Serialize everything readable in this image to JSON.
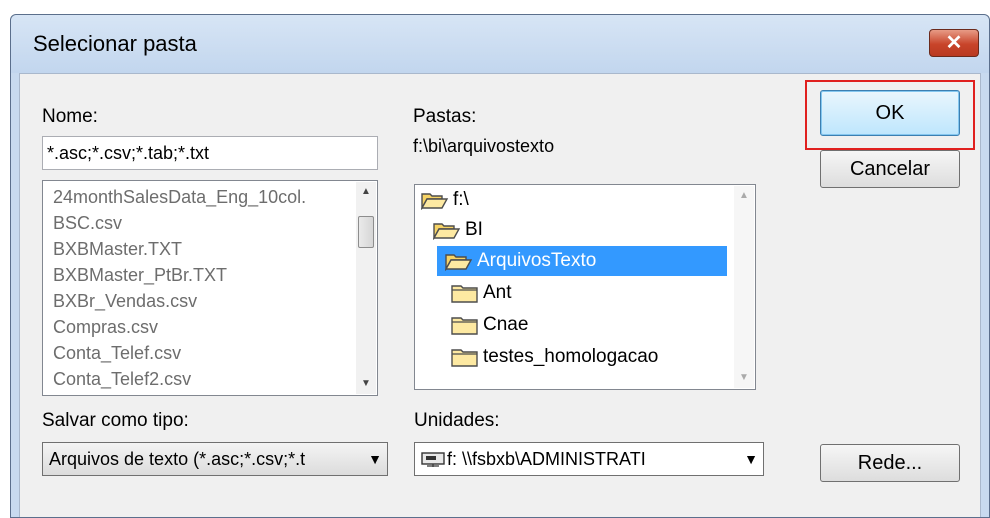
{
  "dialog": {
    "title": "Selecionar pasta",
    "close_glyph": "✕"
  },
  "name_field": {
    "label": "Nome:",
    "value": "*.asc;*.csv;*.tab;*.txt"
  },
  "file_list": {
    "items": [
      "24monthSalesData_Eng_10col.",
      "BSC.csv",
      "BXBMaster.TXT",
      "BXBMaster_PtBr.TXT",
      "BXBr_Vendas.csv",
      "Compras.csv",
      "Conta_Telef.csv",
      "Conta_Telef2.csv"
    ]
  },
  "folders": {
    "label": "Pastas:",
    "current_path": "f:\\bi\\arquivostexto",
    "items": [
      {
        "label": "f:\\",
        "icon": "open-folder-icon"
      },
      {
        "label": "BI",
        "icon": "open-folder-icon"
      },
      {
        "label": "ArquivosTexto",
        "icon": "open-folder-icon"
      },
      {
        "label": "Ant",
        "icon": "folder-icon"
      },
      {
        "label": "Cnae",
        "icon": "folder-icon"
      },
      {
        "label": "testes_homologacao",
        "icon": "folder-icon"
      }
    ],
    "selected": "ArquivosTexto"
  },
  "save_type": {
    "label": "Salvar como tipo:",
    "value": "Arquivos de texto (*.asc;*.csv;*.t"
  },
  "drives": {
    "label": "Unidades:",
    "value": "f: \\\\fsbxb\\ADMINISTRATI",
    "icon": "network-drive-icon"
  },
  "buttons": {
    "ok": "OK",
    "cancel": "Cancelar",
    "network": "Rede..."
  },
  "colors": {
    "selection": "#3399ff",
    "highlight_box": "#e0201f"
  }
}
